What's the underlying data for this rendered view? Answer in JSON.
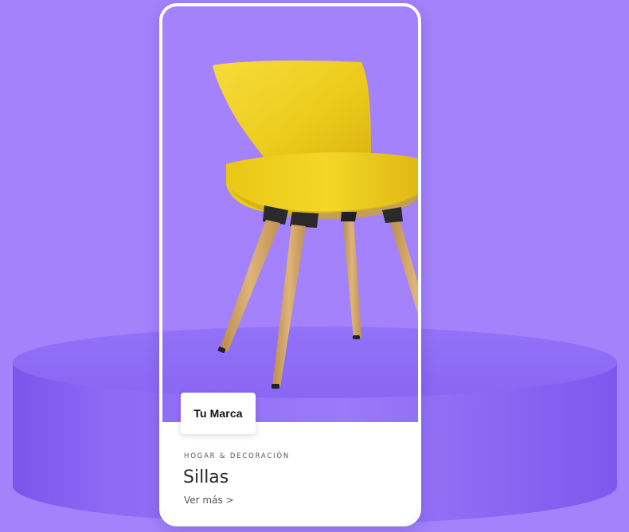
{
  "colors": {
    "background": "#a382fb",
    "pedestal": "#8f6cf6",
    "card_border": "#ffffff",
    "chair": "#f2d21c"
  },
  "card": {
    "brand_label": "Tu Marca",
    "category": "HOGAR & DECORACIÓN",
    "title": "Sillas",
    "more_link": "Ver más >"
  },
  "image": {
    "subject": "yellow-chair-with-wooden-legs"
  }
}
